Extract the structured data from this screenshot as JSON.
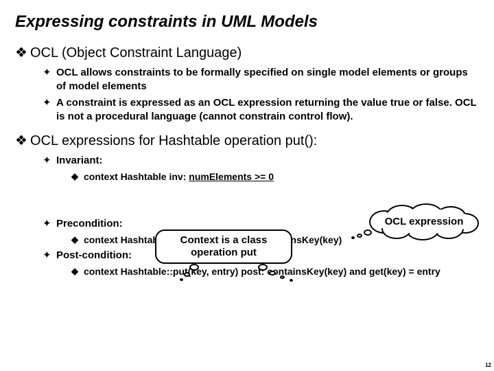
{
  "title": "Expressing constraints in UML Models",
  "sec1": {
    "heading": "OCL (Object Constraint Language)",
    "p1": "OCL allows constraints to be formally specified on single model elements or groups of model elements",
    "p2": "A constraint is expressed as an OCL expression returning the value true or false.  OCL is not a procedural language (cannot constrain control flow)."
  },
  "sec2": {
    "heading": "OCL expressions for Hashtable operation put():",
    "inv_label": "Invariant:",
    "inv_expr_a": "context Hashtable inv: ",
    "inv_expr_b": "numElements >= 0",
    "pre_label": "Precondition:",
    "pre_expr": "context Hashtable::put(key, entry) pre:!containsKey(key)",
    "post_label": "Post-condition:",
    "post_expr": "context Hashtable::put(key, entry) post: containsKey(key) and get(key) = entry"
  },
  "callout": "Context is a class operation put",
  "cloud": "OCL expression",
  "pagenum": "12"
}
